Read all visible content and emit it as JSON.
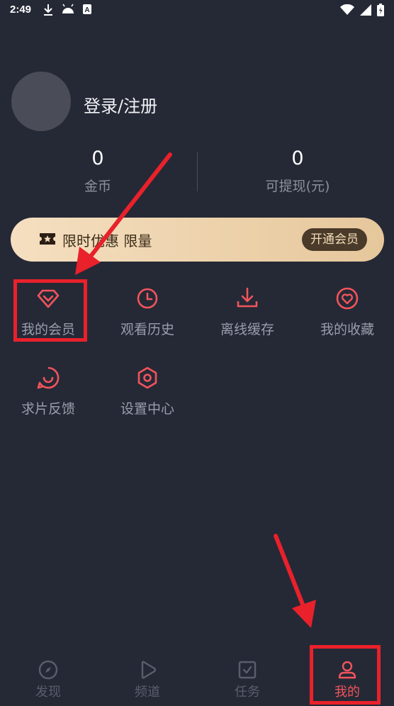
{
  "status_bar": {
    "time": "2:49",
    "left_icons": [
      "download-icon",
      "android-icon",
      "a-icon"
    ],
    "right_icons": [
      "wifi-icon",
      "signal-icon",
      "battery-icon"
    ]
  },
  "profile": {
    "login_text": "登录/注册"
  },
  "stats": [
    {
      "value": "0",
      "label": "金币"
    },
    {
      "value": "0",
      "label": "可提现(元)"
    }
  ],
  "banner": {
    "text": "限时优惠 限量",
    "button_label": "开通会员",
    "icon": "ticket-icon"
  },
  "menu": [
    {
      "label": "我的会员",
      "icon": "diamond-icon"
    },
    {
      "label": "观看历史",
      "icon": "clock-icon"
    },
    {
      "label": "离线缓存",
      "icon": "download-icon"
    },
    {
      "label": "我的收藏",
      "icon": "heart-icon"
    },
    {
      "label": "求片反馈",
      "icon": "feedback-icon"
    },
    {
      "label": "设置中心",
      "icon": "settings-icon"
    }
  ],
  "bottom_nav": [
    {
      "label": "发现",
      "icon": "compass-icon",
      "active": false
    },
    {
      "label": "频道",
      "icon": "play-icon",
      "active": false
    },
    {
      "label": "任务",
      "icon": "task-icon",
      "active": false
    },
    {
      "label": "我的",
      "icon": "user-icon",
      "active": true
    }
  ],
  "colors": {
    "background": "#252936",
    "accent": "#f2545b",
    "annotation": "#e8212b",
    "banner_start": "#f5dfc0",
    "banner_end": "#e6c79c"
  }
}
